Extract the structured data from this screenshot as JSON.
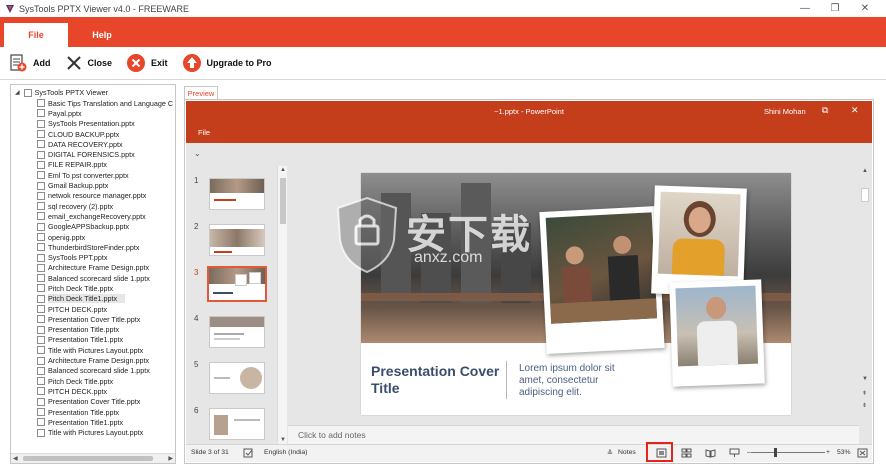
{
  "window": {
    "title": "SysTools PPTX Viewer v4.0 - FREEWARE",
    "controls": [
      "—",
      "❐",
      "✕"
    ]
  },
  "menu": {
    "tabs": [
      {
        "label": "File",
        "active": true
      },
      {
        "label": "Help",
        "active": false
      }
    ]
  },
  "toolbar": {
    "add_label": "Add",
    "close_label": "Close",
    "exit_label": "Exit",
    "upgrade_label": "Upgrade to Pro"
  },
  "tree": {
    "root_label": "SysTools PPTX Viewer",
    "items": [
      "Basic Tips Translation and Language C",
      "Payal.pptx",
      "SysTools Presentation.pptx",
      "CLOUD BACKUP.pptx",
      "DATA RECOVERY.pptx",
      "DIGITAL FORENSICS.pptx",
      "FILE REPAIR.pptx",
      "Eml To pst converter.pptx",
      "Gmail Backup.pptx",
      "netwok resource manager.pptx",
      "sql recovery (2).pptx",
      "email_exchangeRecovery.pptx",
      "GoogleAPPSbackup.pptx",
      "openig.pptx",
      "ThunderbirdStoreFinder.pptx",
      "SysTools PPT.pptx",
      "Architecture Frame Design.pptx",
      "Balanced scorecard slide 1.pptx",
      "Pitch Deck Title.pptx",
      "Pitch Deck Title1.pptx",
      "PITCH DECK.pptx",
      "Presentation Cover Title.pptx",
      "Presentation Title.pptx",
      "Presentation Title1.pptx",
      "Title with Pictures Layout.pptx",
      "Architecture Frame Design.pptx",
      "Balanced scorecard slide 1.pptx",
      "Pitch Deck Title.pptx",
      "PITCH DECK.pptx",
      "Presentation Cover Title.pptx",
      "Presentation Title.pptx",
      "Presentation Title1.pptx",
      "Title with Pictures Layout.pptx"
    ],
    "selected_index": 19
  },
  "preview_tab": "Preview",
  "powerpoint": {
    "doc_title": "~1.pptx  -  PowerPoint",
    "user": "Shini Mohan",
    "file_menu": "File",
    "slide_numbers": [
      "1",
      "2",
      "3",
      "4",
      "5",
      "6"
    ],
    "active_slide": 3,
    "slide": {
      "title": "Presentation Cover Title",
      "subtitle": "Lorem ipsum dolor sit amet, consectetur adipiscing elit."
    },
    "notes_placeholder": "Click to add notes",
    "status": {
      "slide_info": "Slide 3 of 31",
      "language": "English (India)",
      "notes_label": "Notes",
      "zoom": "53%"
    }
  },
  "watermark": {
    "cn": "安下载",
    "en": "anxz.com"
  },
  "colors": {
    "accent": "#e8462a",
    "ppt_red": "#c43e1c",
    "slide_title": "#3a4e6c",
    "highlight_box": "#e8231d"
  }
}
